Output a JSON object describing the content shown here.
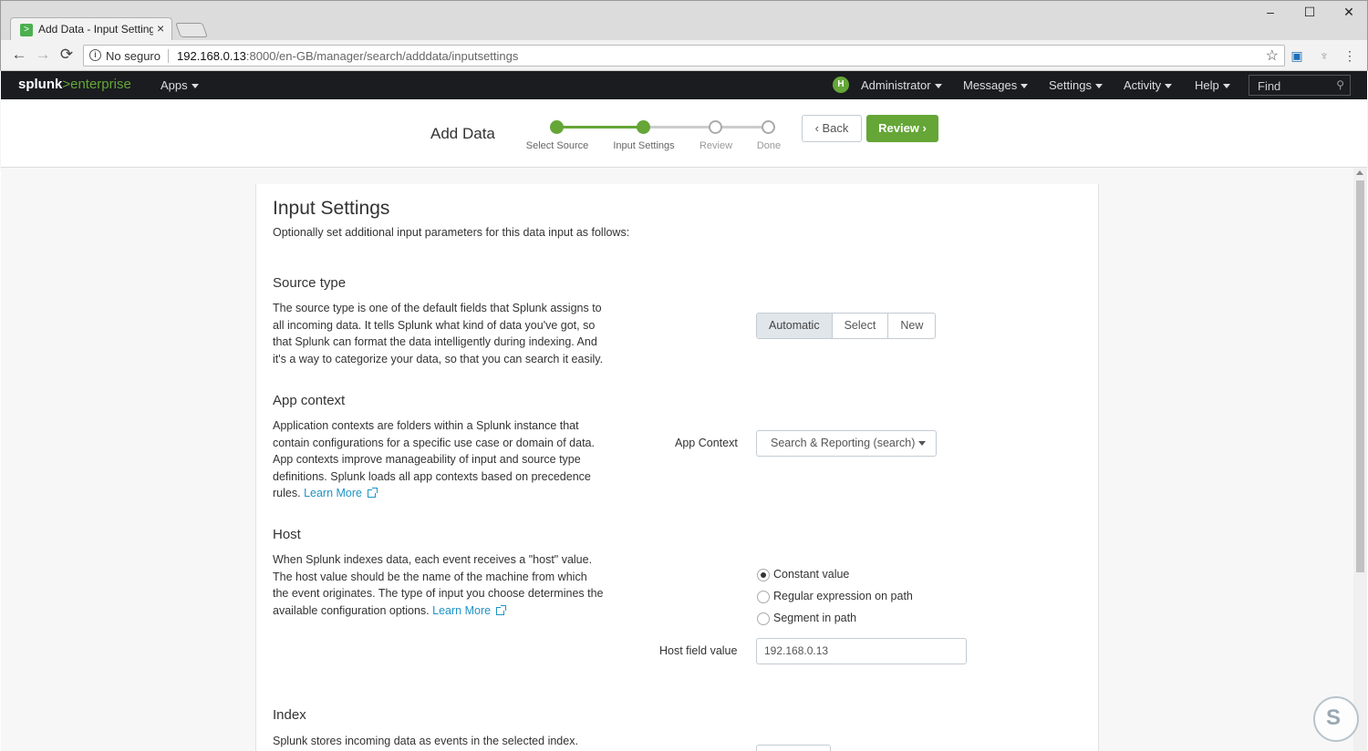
{
  "browser": {
    "tab_title": "Add Data - Input Settings",
    "tab_close": "×",
    "security": "No seguro",
    "url_host": "192.168.0.13",
    "url_path": ":8000/en-GB/manager/search/adddata/inputsettings",
    "window_controls": [
      "–",
      "☐",
      "✕"
    ]
  },
  "splunkbar": {
    "logo_splunk": "splunk",
    "logo_gt": ">",
    "logo_enterprise": "enterprise",
    "apps": "Apps",
    "avatar_initial": "H",
    "administrator": "Administrator",
    "messages": "Messages",
    "settings": "Settings",
    "activity": "Activity",
    "help": "Help",
    "find_placeholder": "Find"
  },
  "wizard": {
    "title": "Add Data",
    "steps": [
      {
        "label": "Select Source",
        "state": "done"
      },
      {
        "label": "Input Settings",
        "state": "current"
      },
      {
        "label": "Review",
        "state": "todo"
      },
      {
        "label": "Done",
        "state": "todo"
      }
    ],
    "back_label": "Back",
    "review_label": "Review",
    "accent": "#65a637"
  },
  "page": {
    "title": "Input Settings",
    "subtitle": "Optionally set additional input parameters for this data input as follows:"
  },
  "source_type": {
    "title": "Source type",
    "description": "The source type is one of the default fields that Splunk assigns to all incoming data. It tells Splunk what kind of data you've got, so that Splunk can format the data intelligently during indexing. And it's a way to categorize your data, so that you can search it easily.",
    "options": [
      "Automatic",
      "Select",
      "New"
    ],
    "selected": "Automatic"
  },
  "app_context": {
    "title": "App context",
    "description": "Application contexts are folders within a Splunk instance that contain configurations for a specific use case or domain of data. App contexts improve manageability of input and source type definitions. Splunk loads all app contexts based on precedence rules.",
    "learn_more": "Learn More",
    "field_label": "App Context",
    "value": "Search & Reporting (search)"
  },
  "host": {
    "title": "Host",
    "description": "When Splunk indexes data, each event receives a \"host\" value. The host value should be the name of the machine from which the event originates. The type of input you choose determines the available configuration options.",
    "learn_more": "Learn More",
    "options": [
      "Constant value",
      "Regular expression on path",
      "Segment in path"
    ],
    "selected": "Constant value",
    "field_label": "Host field value",
    "field_value": "192.168.0.13"
  },
  "index": {
    "title": "Index",
    "description": "Splunk stores incoming data as events in the selected index."
  }
}
